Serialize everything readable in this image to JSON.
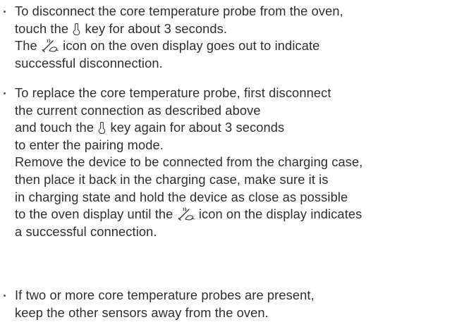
{
  "instructions": {
    "bullets": [
      {
        "lines": [
          {
            "text": "To disconnect the core temperature probe from the oven,"
          },
          {
            "pre": "touch the ",
            "icon": "probe-key-icon",
            "post": " key for about 3 seconds."
          },
          {
            "pre": "The ",
            "icon": "probe-connection-icon",
            "post": " icon on the oven display goes out to indicate"
          },
          {
            "text": "successful disconnection."
          }
        ]
      },
      {
        "lines": [
          {
            "text": "To replace the core temperature probe, first disconnect"
          },
          {
            "text": "the current connection as described above"
          },
          {
            "pre": "and touch the ",
            "icon": "probe-key-icon",
            "post": " key again for about 3 seconds"
          },
          {
            "text": "to enter the pairing mode."
          },
          {
            "text": "Remove the device to be connected from the charging case,"
          },
          {
            "text": "then place it back in the charging case, make sure it is"
          },
          {
            "text": "in charging state and hold the device as close as possible"
          },
          {
            "pre": "to the oven display until the ",
            "icon": "probe-connection-icon",
            "post": " icon on the display indicates"
          },
          {
            "text": "a successful connection."
          }
        ]
      },
      {
        "lines": [
          {
            "text": "If two or more core temperature probes are present,"
          },
          {
            "text": "keep the other sensors away from the oven."
          }
        ]
      }
    ]
  }
}
